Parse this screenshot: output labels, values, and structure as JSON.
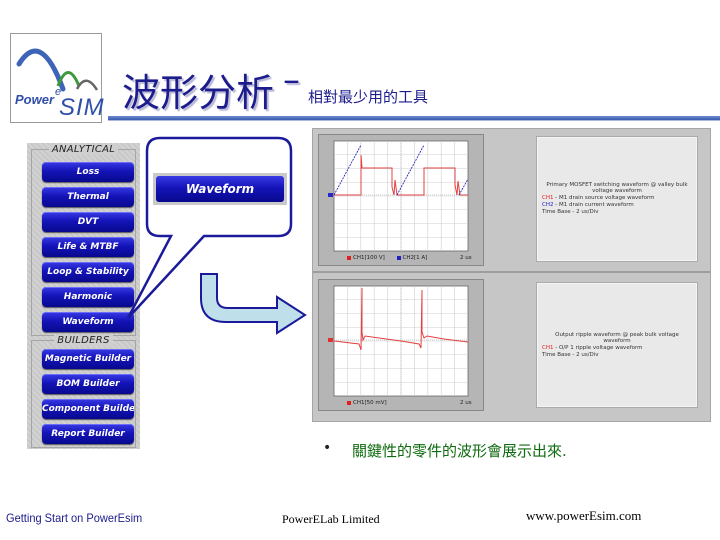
{
  "logo": {
    "power": "Power",
    "e": "e",
    "sim": "SIM"
  },
  "title": {
    "main": "波形分析",
    "dash": "–",
    "subtitle": "相對最少用的工具"
  },
  "sidebar": {
    "groups": [
      {
        "label": "ANALYTICAL",
        "items": [
          "Loss",
          "Thermal",
          "DVT",
          "Life & MTBF",
          "Loop & Stability",
          "Harmonic",
          "Waveform"
        ]
      },
      {
        "label": "BUILDERS",
        "items": [
          "Magnetic Builder",
          "BOM Builder",
          "Component Builder",
          "Report Builder"
        ]
      }
    ]
  },
  "callout": {
    "button_label": "Waveform"
  },
  "waveforms": [
    {
      "legend": [
        {
          "label": "CH1[100 V]",
          "color": "#e02020"
        },
        {
          "label": "CH2[1 A]",
          "color": "#2020c0"
        }
      ],
      "timebase": "2 us",
      "description": {
        "title": "Primary MOSFET switching waveform @ valley bulk voltage waveform",
        "lines": [
          {
            "tag": "CH1",
            "tag_color": "#e02020",
            "text": "- M1 drain source voltage waveform"
          },
          {
            "tag": "CH2",
            "tag_color": "#2020c0",
            "text": "- M1 drain current waveform"
          },
          {
            "tag": "",
            "text": "Time Base - 2 us/Div"
          }
        ]
      }
    },
    {
      "legend": [
        {
          "label": "CH1[50 mV]",
          "color": "#e02020"
        }
      ],
      "timebase": "2 us",
      "description": {
        "title": "Output ripple waveform @ peak bulk voltage waveform",
        "lines": [
          {
            "tag": "CH1",
            "tag_color": "#e02020",
            "text": "- O/P 1 ripple voltage waveform"
          },
          {
            "tag": "",
            "text": "Time Base - 2 us/Div"
          }
        ]
      }
    }
  ],
  "bullet": {
    "dot": "•",
    "text": "關鍵性的零件的波形會展示出來."
  },
  "footer": {
    "left": "Getting Start on PowerEsim",
    "center": "PowerELab Limited",
    "right": "www.powerEsim.com"
  },
  "colors": {
    "accent": "#1c1c8c",
    "button": "#1414b8",
    "bullet_text": "#0f6b0f",
    "ch1": "#e02020",
    "ch2": "#2020c0"
  }
}
